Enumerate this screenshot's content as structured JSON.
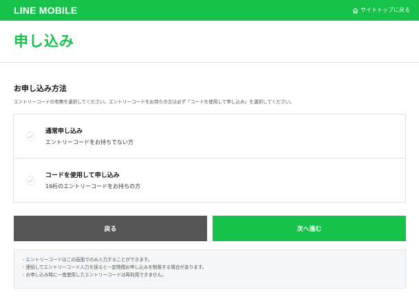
{
  "header": {
    "logo": "LINE MOBILE",
    "top_link_label": "サイトトップに戻る"
  },
  "page": {
    "title": "申し込み"
  },
  "method": {
    "title": "お申し込み方法",
    "description": "エントリーコードの有無を選択してください。エントリーコードをお持ちの方は必ず「コードを使用して申し込み」を選択してください。",
    "options": [
      {
        "title": "通常申し込み",
        "subtitle": "エントリーコードをお持ちでない方"
      },
      {
        "title": "コードを使用して申し込み",
        "subtitle": "16桁のエントリーコードをお持ちの方"
      }
    ]
  },
  "buttons": {
    "back_label": "戻る",
    "next_label": "次へ進む"
  },
  "notes": [
    "- エントリーコードはこの画面でのみ入力することができます。",
    "- 連続してエントリーコード入力を誤ると一定時間お申し込みを制限する場合があります。",
    "- お申し込み時に一度使用したエントリーコードは再利用できません。"
  ],
  "colors": {
    "brand_green": "#17c24a",
    "back_button": "#555555",
    "notes_bg": "#f5f6f7"
  },
  "icons": {
    "home": "home-icon",
    "check": "check-icon"
  }
}
